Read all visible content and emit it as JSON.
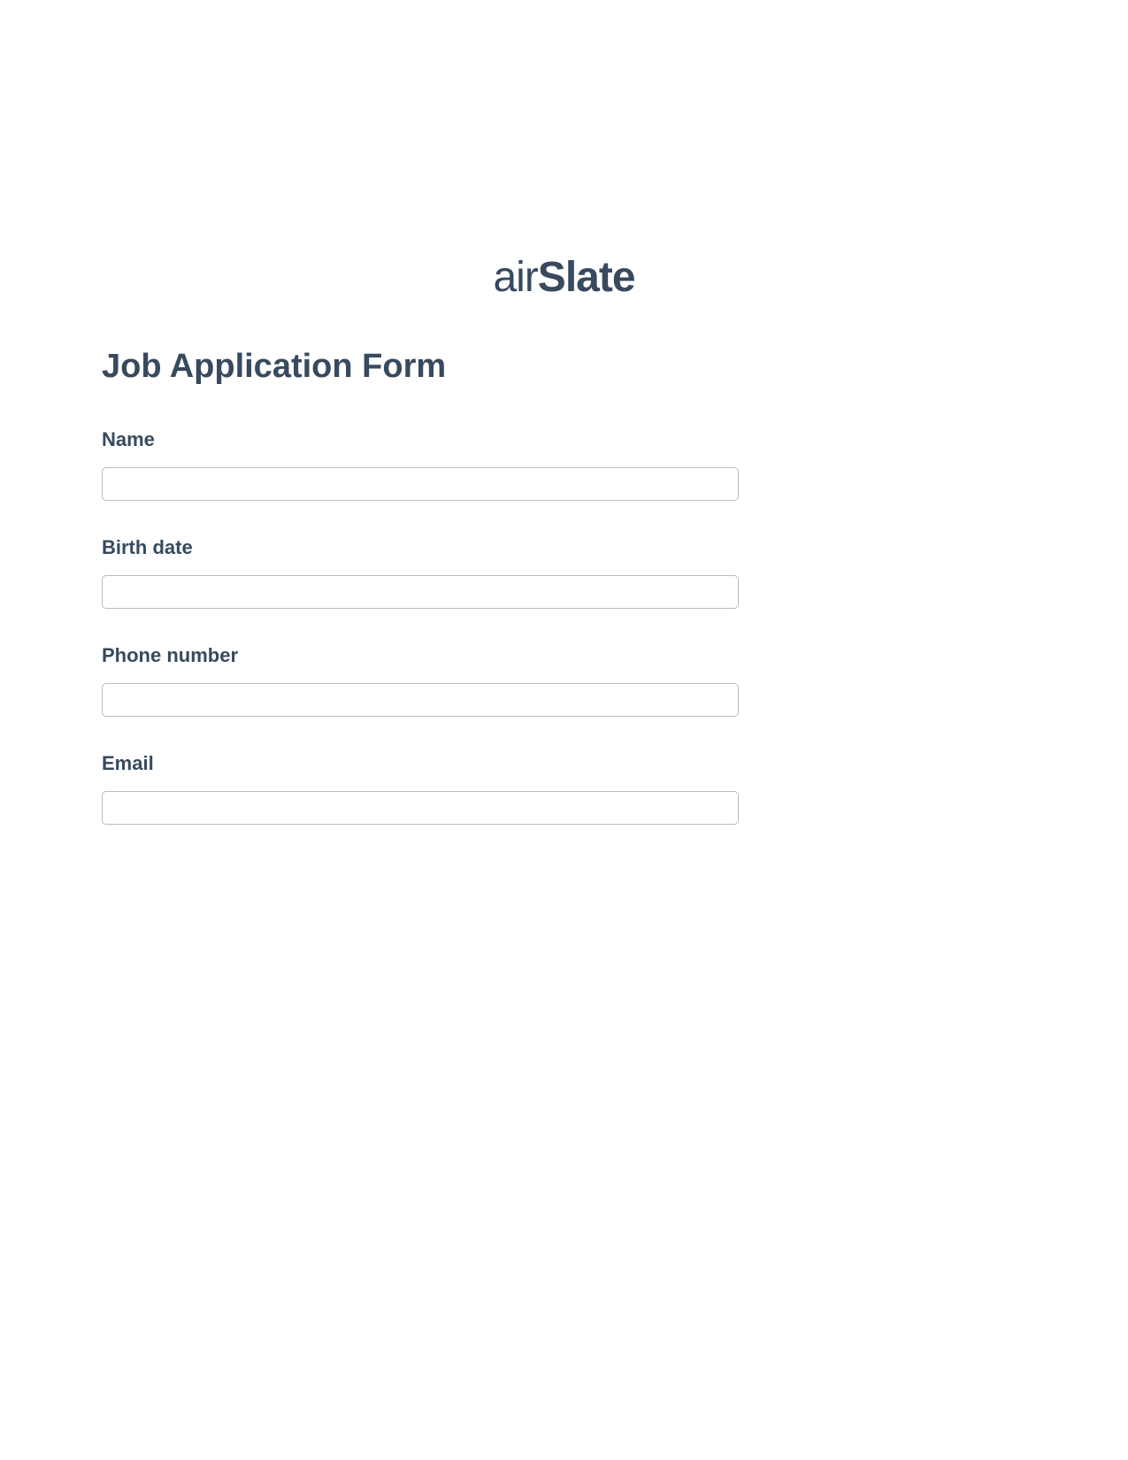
{
  "logo": {
    "part1": "air",
    "part2": "Slate"
  },
  "form": {
    "title": "Job Application Form",
    "fields": [
      {
        "label": "Name",
        "value": ""
      },
      {
        "label": "Birth date",
        "value": ""
      },
      {
        "label": "Phone number",
        "value": ""
      },
      {
        "label": "Email",
        "value": ""
      }
    ]
  }
}
